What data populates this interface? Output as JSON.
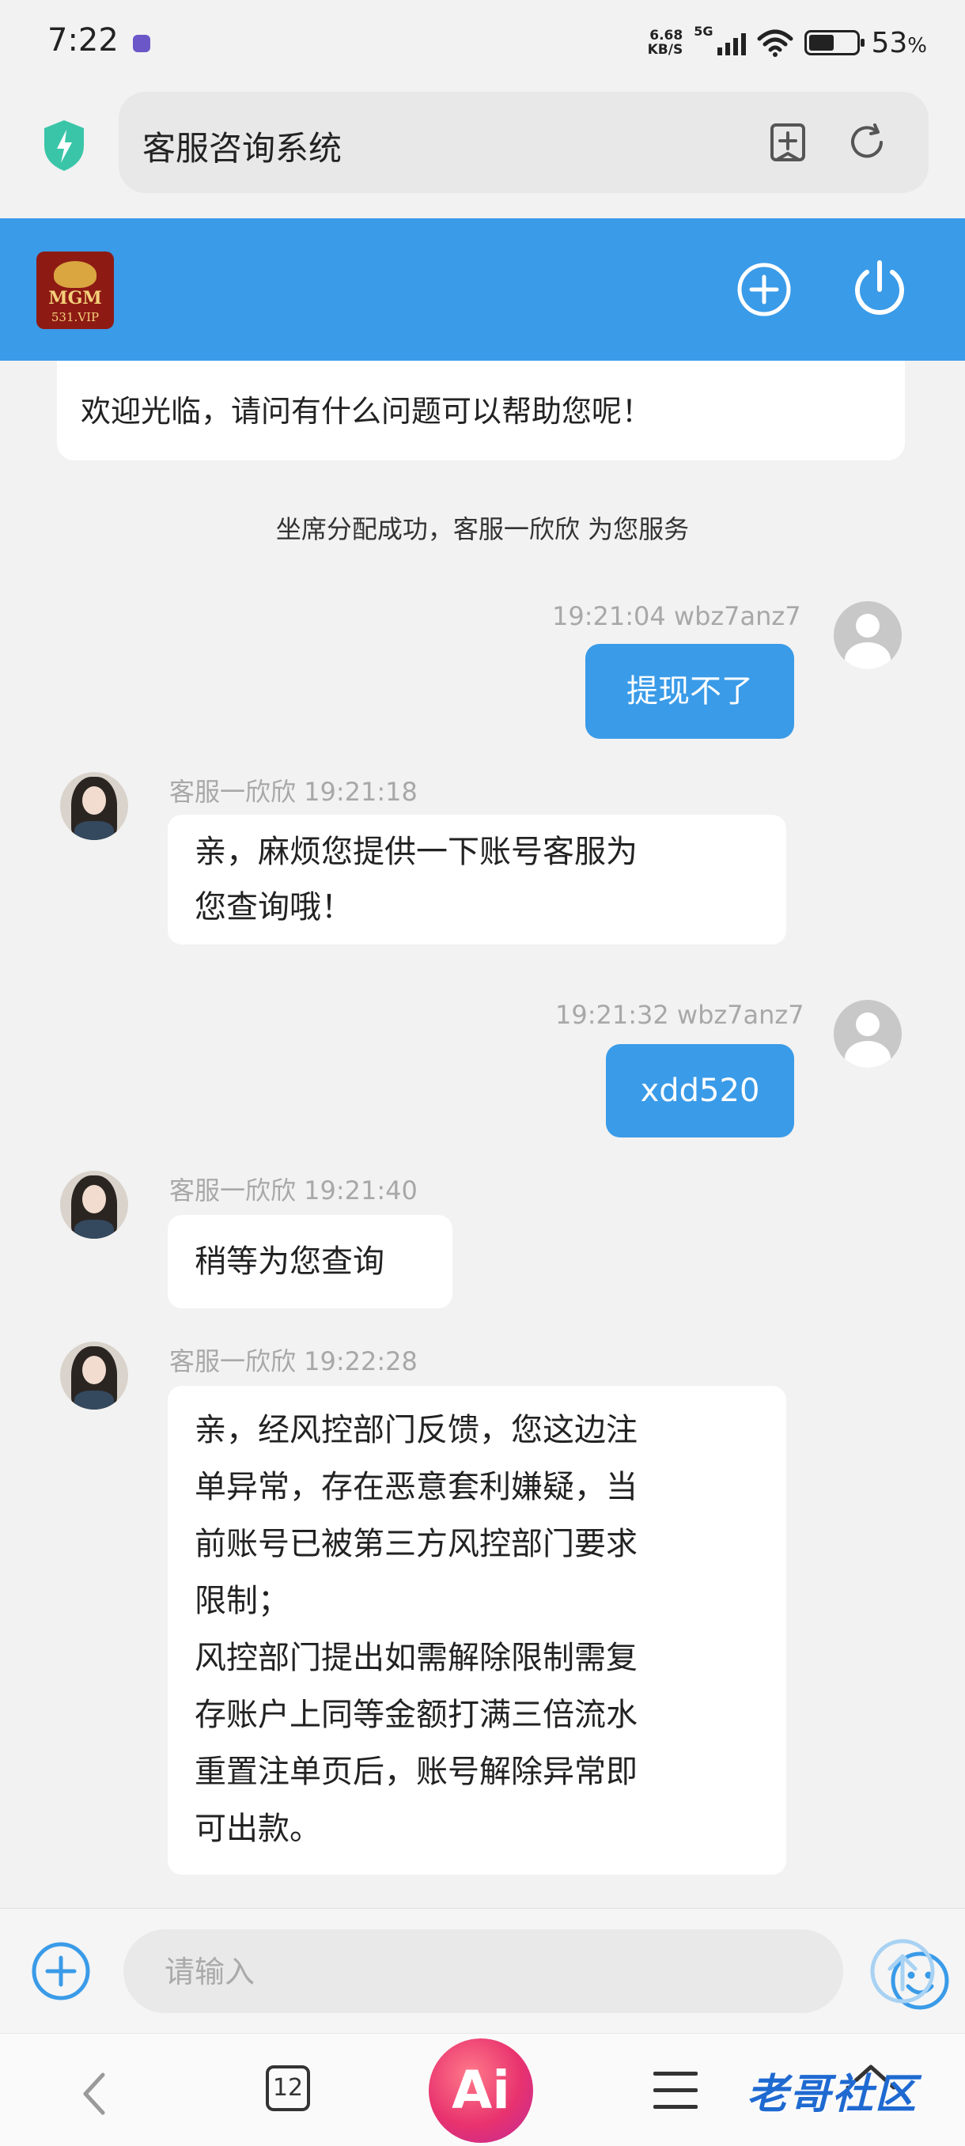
{
  "status_bar": {
    "time": "7:22",
    "net_speed_value": "6.68",
    "net_speed_unit": "KB/S",
    "network_type": "5G",
    "battery_percent": "53",
    "battery_unit": "%",
    "battery_level": 0.53
  },
  "browser": {
    "page_title": "客服咨询系统",
    "shield_color": "#3ac5a8"
  },
  "app_header": {
    "logo_text": "MGM",
    "logo_subtext": "531.VIP",
    "brand_color": "#3a9be8"
  },
  "chat": {
    "welcome": "欢迎光临，请问有什么问题可以帮助您呢！",
    "system_message": "坐席分配成功，客服一欣欣 为您服务",
    "messages": [
      {
        "from": "user",
        "meta": "19:21:04 wbz7anz7",
        "text": "提现不了"
      },
      {
        "from": "agent",
        "meta": "客服一欣欣 19:21:18",
        "lines": [
          "亲，麻烦您提供一下账号客服为",
          "您查询哦！"
        ]
      },
      {
        "from": "user",
        "meta": "19:21:32 wbz7anz7",
        "text": "xdd520"
      },
      {
        "from": "agent",
        "meta": "客服一欣欣 19:21:40",
        "lines": [
          "稍等为您查询"
        ]
      },
      {
        "from": "agent",
        "meta": "客服一欣欣 19:22:28",
        "lines": [
          "亲，经风控部门反馈，您这边注",
          "单异常，存在恶意套利嫌疑，当",
          "前账号已被第三方风控部门要求",
          "限制；",
          "风控部门提出如需解除限制需复",
          "存账户上同等金额打满三倍流水",
          "重置注单页后，账号解除异常即",
          "可出款。"
        ]
      }
    ]
  },
  "input_bar": {
    "placeholder": "请输入"
  },
  "nav": {
    "tab_count": "12",
    "ai_label": "Ai",
    "watermark": "老哥社区"
  }
}
